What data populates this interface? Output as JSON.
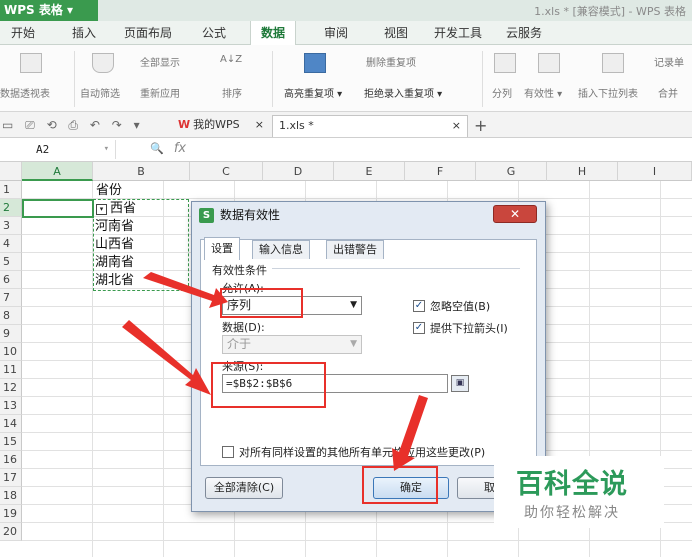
{
  "app": {
    "menu_button": "WPS 表格 ▾",
    "doc_title": "1.xls * [兼容模式] - WPS 表格"
  },
  "ribbon_tabs": [
    "开始",
    "插入",
    "页面布局",
    "公式",
    "数据",
    "审阅",
    "视图",
    "开发工具",
    "云服务"
  ],
  "ribbon": {
    "pivot_table": "数据透视表",
    "auto_filter": "自动筛选",
    "show_all": "全部显示",
    "reapply": "重新应用",
    "sort_asc": "A↓Z",
    "sort": "排序",
    "highlight_dup": "高亮重复项 ▾",
    "delete_dup": "删除重复项",
    "reject_dup": "拒绝录入重复项 ▾",
    "split": "分列",
    "validity": "有效性 ▾",
    "insert_dropdown": "插入下拉列表",
    "record_list": "记录单",
    "consolidate": "合并"
  },
  "quick_access": {
    "icons": "▭ ⎚ ⟲ ⎙ ↶ ↷ ▾",
    "tab_mywps_logo": "W",
    "tab_mywps": "我的WPS",
    "tab_mywps_close": "×",
    "tab_file": "1.xls *",
    "tab_file_close": "×",
    "new_tab": "+"
  },
  "formula_bar": {
    "name_box": "A2",
    "name_box_arrow": "▾",
    "zoom_icon": "🔍",
    "fx": "fx"
  },
  "columns": [
    "A",
    "B",
    "C",
    "D",
    "E",
    "F",
    "G",
    "H",
    "I"
  ],
  "rows": [
    "1",
    "2",
    "3",
    "4",
    "5",
    "6",
    "7",
    "8",
    "9",
    "10",
    "11",
    "12",
    "13",
    "14",
    "15",
    "16",
    "17",
    "18",
    "19",
    "20"
  ],
  "cells": {
    "b1": "省份",
    "b2": "西省",
    "b3": "河南省",
    "b4": "山西省",
    "b5": "湖南省",
    "b6": "湖北省",
    "dropdown_arrow": "▾"
  },
  "dialog": {
    "logo": "S",
    "title": "数据有效性",
    "close": "✕",
    "tabs": [
      "设置",
      "输入信息",
      "出错警告"
    ],
    "group_label": "有效性条件",
    "allow_label": "允许(A):",
    "allow_value": "序列",
    "data_label": "数据(D):",
    "data_value": "介于",
    "source_label": "来源(S):",
    "source_value": "=$B$2:$B$6",
    "ignore_blank": "忽略空值(B)",
    "in_cell_dropdown": "提供下拉箭头(I)",
    "check_mark": "✓",
    "apply_all": "对所有同样设置的其他所有单元格应用这些更改(P)",
    "clear_all": "全部清除(C)",
    "ok": "确定",
    "cancel": "取消",
    "pick_icon": "▣",
    "select_arrow": "▼"
  },
  "watermark": {
    "title": "百科全说",
    "subtitle": "助你轻松解决"
  },
  "colors": {
    "accent": "#3a9a4e",
    "annotation": "#e8302a",
    "watermark": "#2c9a5a"
  }
}
